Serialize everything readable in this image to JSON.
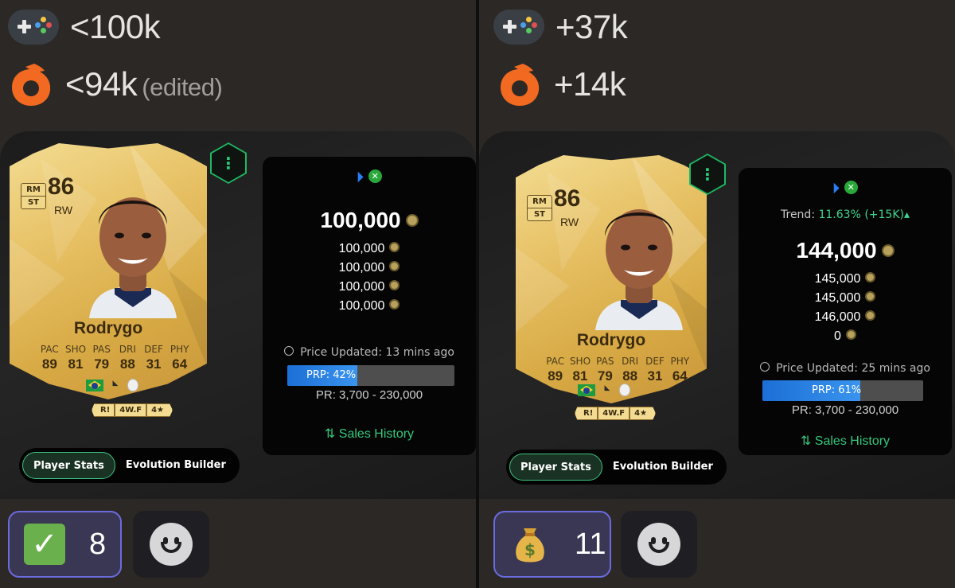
{
  "panels": [
    {
      "console_value": "<100k",
      "pc_value": "<94k",
      "pc_note": "(edited)",
      "card": {
        "rating": "86",
        "position": "RW",
        "alt_positions": [
          "RM",
          "ST"
        ],
        "name": "Rodrygo",
        "stat_labels": [
          "PAC",
          "SHO",
          "PAS",
          "DRI",
          "DEF",
          "PHY"
        ],
        "stat_values": [
          "89",
          "81",
          "79",
          "88",
          "31",
          "64"
        ],
        "traits": [
          "R!",
          "4W.F",
          "4★"
        ]
      },
      "market": {
        "trend_label": "",
        "trend_value": "",
        "price": "100,000",
        "listings": [
          "100,000",
          "100,000",
          "100,000",
          "100,000"
        ],
        "updated": "Price Updated: 13 mins ago",
        "prp_label": "PRP: 42%",
        "prp_percent": 42,
        "pr_range": "PR: 3,700 - 230,000",
        "sales_label": "Sales History"
      },
      "tabs": {
        "player_stats": "Player Stats",
        "evolution_builder": "Evolution Builder"
      },
      "reaction": {
        "emoji": "check-mark",
        "count": "8"
      }
    },
    {
      "console_value": "+37k",
      "pc_value": "+14k",
      "pc_note": "",
      "card": {
        "rating": "86",
        "position": "RW",
        "alt_positions": [
          "RM",
          "ST"
        ],
        "name": "Rodrygo",
        "stat_labels": [
          "PAC",
          "SHO",
          "PAS",
          "DRI",
          "DEF",
          "PHY"
        ],
        "stat_values": [
          "89",
          "81",
          "79",
          "88",
          "31",
          "64"
        ],
        "traits": [
          "R!",
          "4W.F",
          "4★"
        ]
      },
      "market": {
        "trend_label": "Trend: ",
        "trend_value": "11.63% (+15K)▴",
        "price": "144,000",
        "listings": [
          "145,000",
          "145,000",
          "146,000",
          "0"
        ],
        "updated": "Price Updated: 25 mins ago",
        "prp_label": "PRP: 61%",
        "prp_percent": 61,
        "pr_range": "PR: 3,700 - 230,000",
        "sales_label": "Sales History"
      },
      "tabs": {
        "player_stats": "Player Stats",
        "evolution_builder": "Evolution Builder"
      },
      "reaction": {
        "emoji": "money-bag",
        "count": "11"
      }
    }
  ],
  "icons": {
    "console": "gamepad-icon",
    "pc": "origin-icon",
    "playstation": "playstation-icon",
    "xbox": "xbox-icon",
    "coin": "coin-icon",
    "clock": "clock-icon",
    "sales": "sort-arrows-icon",
    "more": "more-vertical-icon",
    "add_reaction": "smiley-icon"
  },
  "colors": {
    "panel_bg": "#2c2825",
    "accent_green": "#35c77d",
    "prp_blue": "#2a84e6",
    "reaction_border": "#6b6be0",
    "origin_orange": "#f26a21"
  }
}
